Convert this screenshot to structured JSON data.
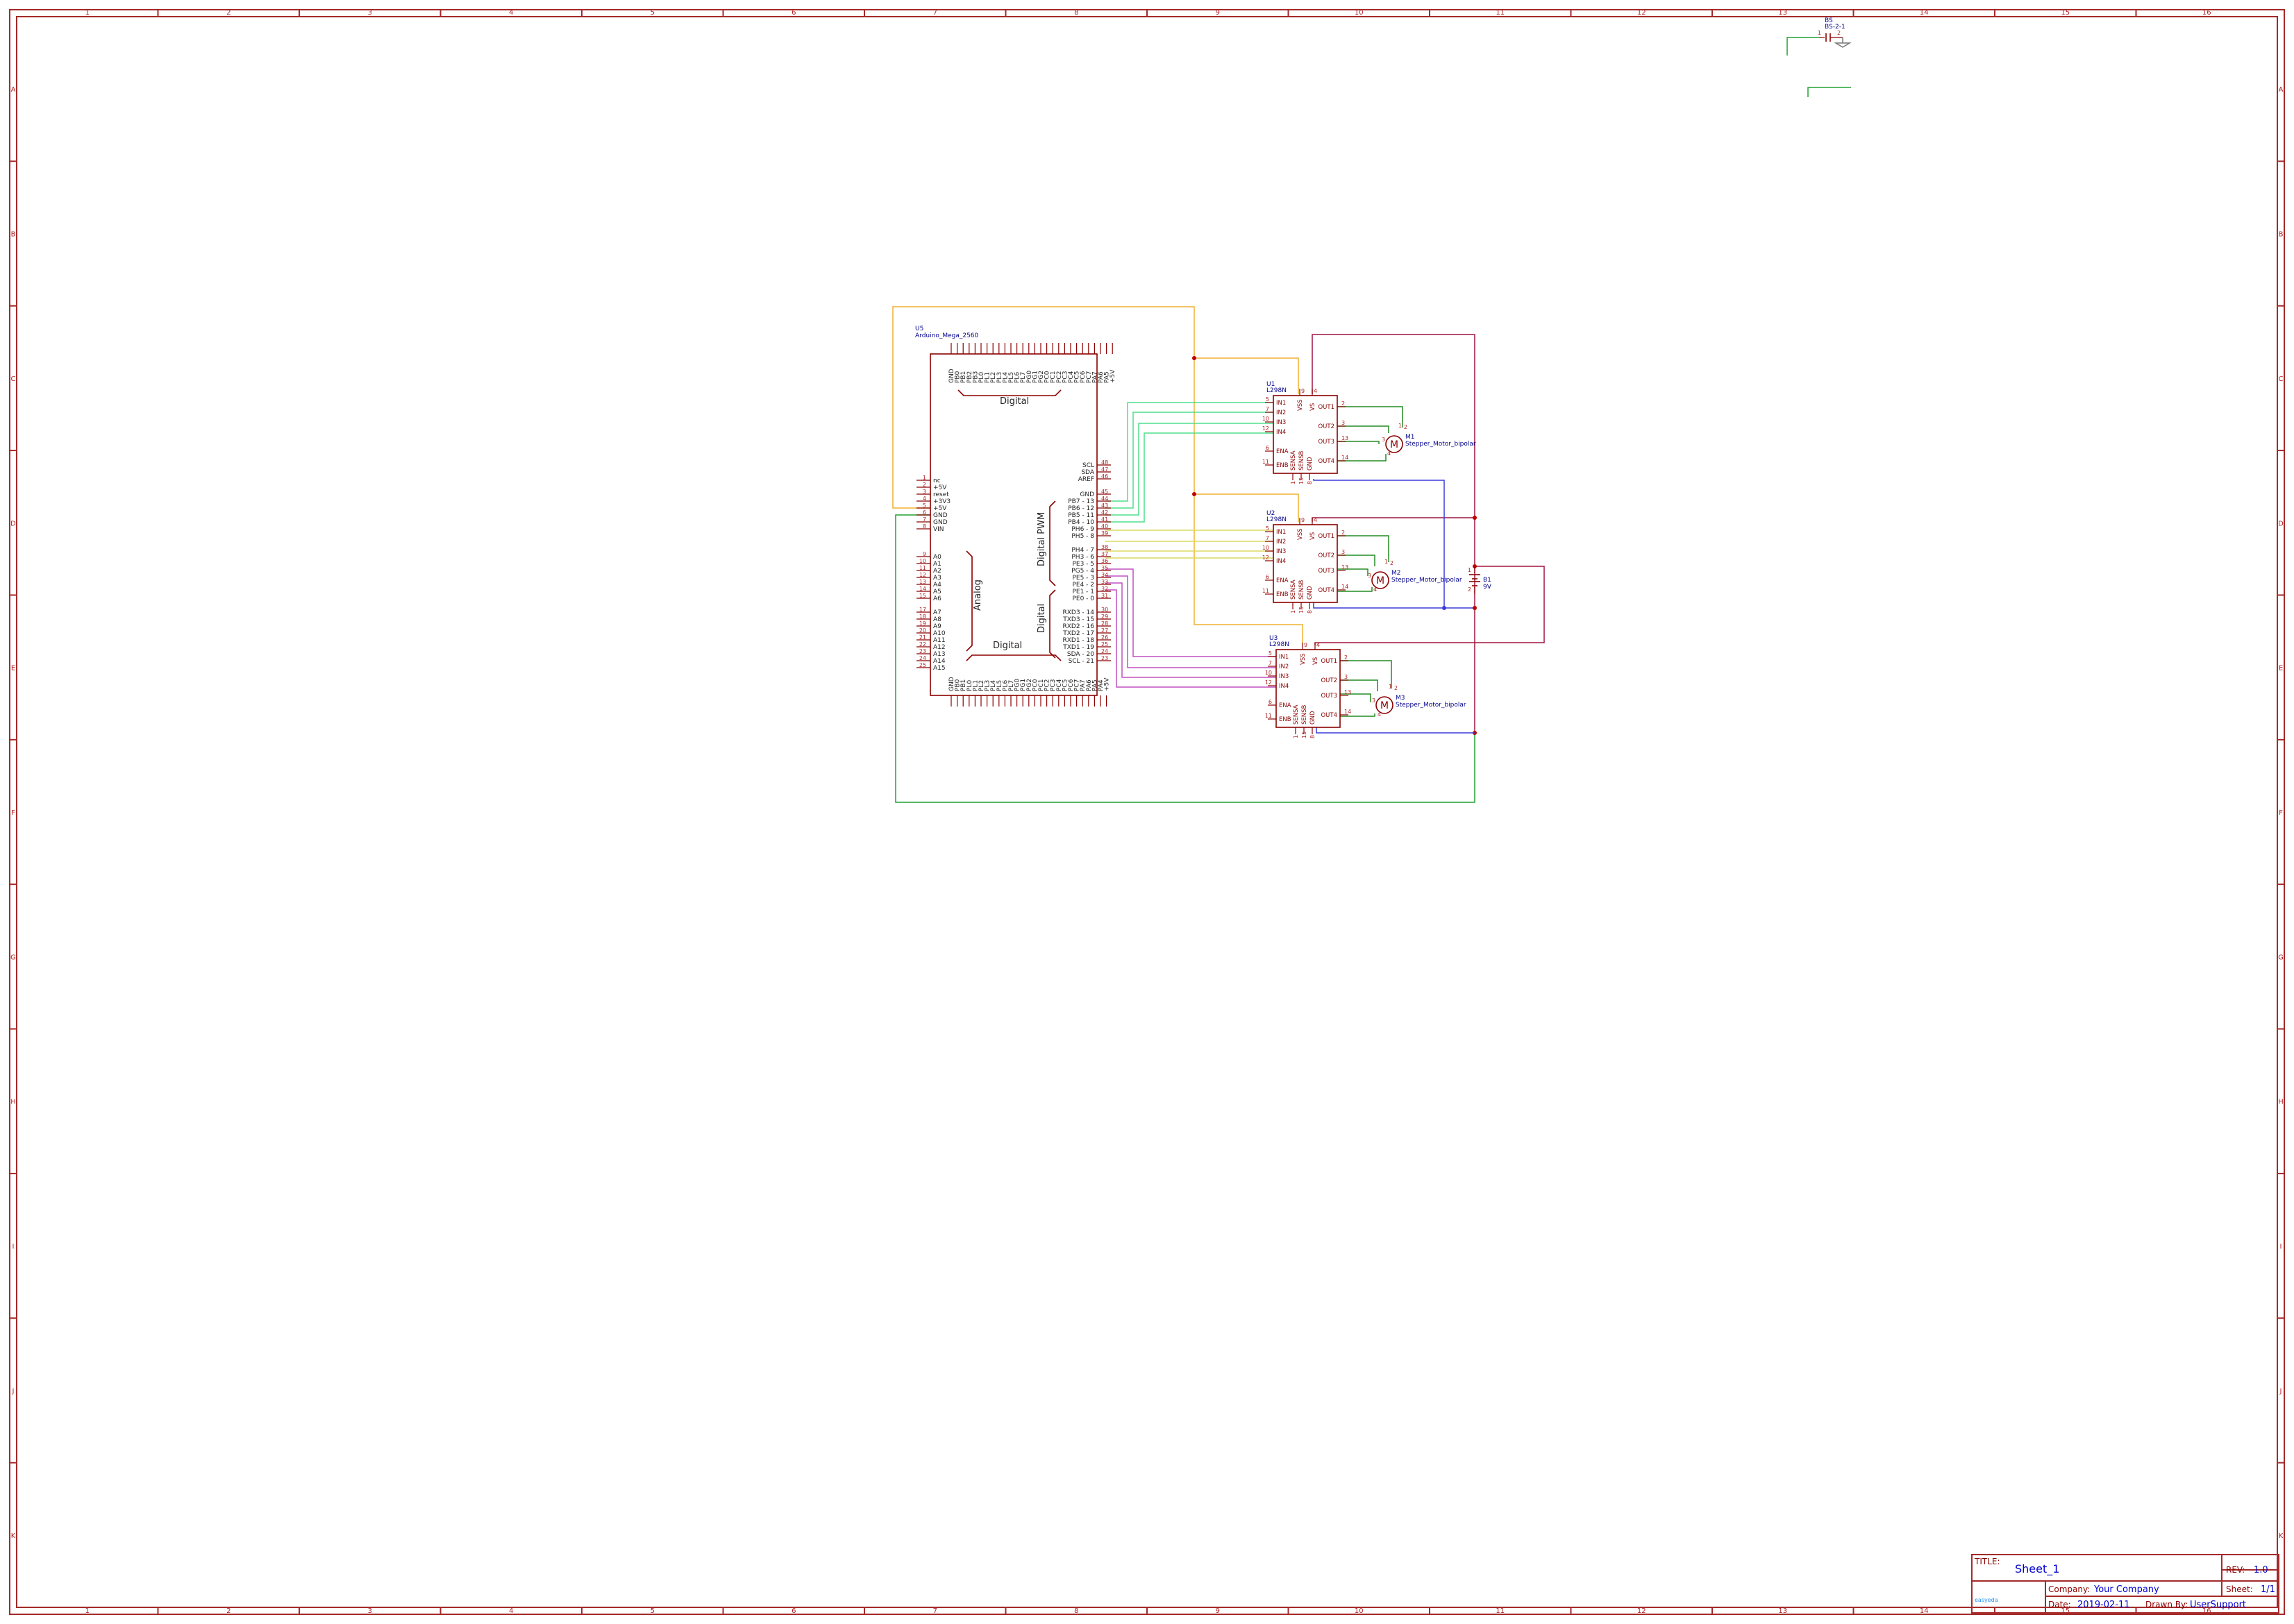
{
  "colors": {
    "frame": "#a52a2a",
    "component": "#8b0000",
    "reference": "#00008b",
    "wire_power": "#a0153e",
    "wire_gnd_bus": "#22a033",
    "wire_motor": "#228b22",
    "wire_yellow": "#f0b030",
    "wire_blue": "#3b3bdb",
    "wire_green_light": "#4ddf8c",
    "wire_yellow_light": "#dada60",
    "wire_violet": "#c050c0"
  },
  "frame": {
    "columns": [
      "1",
      "2",
      "3",
      "4",
      "5",
      "6",
      "7",
      "8",
      "9",
      "10",
      "11",
      "12",
      "13",
      "14",
      "15",
      "16"
    ],
    "rows": [
      "A",
      "B",
      "C",
      "D",
      "E",
      "F",
      "G",
      "H",
      "I",
      "J",
      "K"
    ]
  },
  "arduino": {
    "ref": "U5",
    "value": "Arduino_Mega_2560",
    "top_pins": [
      "GND",
      "PB0",
      "PB1",
      "PB2",
      "PB3",
      "PL0",
      "PL1",
      "PL2",
      "PL3",
      "PL4",
      "PL5",
      "PL6",
      "PL7",
      "PG0",
      "PG1",
      "PG2",
      "PC0",
      "PC1",
      "PC2",
      "PC3",
      "PC4",
      "PC5",
      "PC6",
      "PC7",
      "PA7",
      "PA6",
      "PA5",
      "+5V"
    ],
    "bottom_pins": [
      "GND",
      "PB0",
      "PB1",
      "PL0",
      "PL1",
      "PL2",
      "PL3",
      "PL4",
      "PL5",
      "PL6",
      "PL7",
      "PG0",
      "PG1",
      "PG2",
      "PC0",
      "PC1",
      "PC2",
      "PC3",
      "PC4",
      "PC5",
      "PC6",
      "PC7",
      "PA7",
      "PA6",
      "PA5",
      "PA4",
      "+5V"
    ],
    "left_power": [
      {
        "num": "1",
        "name": "nc"
      },
      {
        "num": "2",
        "name": "+5V"
      },
      {
        "num": "3",
        "name": "reset"
      },
      {
        "num": "4",
        "name": "+3V3"
      },
      {
        "num": "5",
        "name": "+5V"
      },
      {
        "num": "6",
        "name": "GND"
      },
      {
        "num": "7",
        "name": "GND"
      },
      {
        "num": "8",
        "name": "VIN"
      }
    ],
    "left_analog_a": [
      {
        "num": "9",
        "name": "A0"
      },
      {
        "num": "10",
        "name": "A1"
      },
      {
        "num": "11",
        "name": "A2"
      },
      {
        "num": "12",
        "name": "A3"
      },
      {
        "num": "13",
        "name": "A4"
      },
      {
        "num": "14",
        "name": "A5"
      },
      {
        "num": "15",
        "name": "A6"
      }
    ],
    "left_analog_b": [
      {
        "num": "17",
        "name": "A7"
      },
      {
        "num": "18",
        "name": "A8"
      },
      {
        "num": "19",
        "name": "A9"
      },
      {
        "num": "20",
        "name": "A10"
      },
      {
        "num": "21",
        "name": "A11"
      },
      {
        "num": "22",
        "name": "A12"
      },
      {
        "num": "23",
        "name": "A13"
      },
      {
        "num": "24",
        "name": "A14"
      },
      {
        "num": "25",
        "name": "A15"
      }
    ],
    "right_top": [
      {
        "num": "48",
        "name": "SCL"
      },
      {
        "num": "47",
        "name": "SDA"
      },
      {
        "num": "46",
        "name": "AREF"
      }
    ],
    "right_pwm": [
      {
        "num": "45",
        "name": "GND"
      },
      {
        "num": "44",
        "name": "PB7 - 13"
      },
      {
        "num": "43",
        "name": "PB6 - 12"
      },
      {
        "num": "42",
        "name": "PB5 - 11"
      },
      {
        "num": "41",
        "name": "PB4 - 10"
      },
      {
        "num": "40",
        "name": "PH6 - 9"
      },
      {
        "num": "39",
        "name": "PH5 - 8"
      }
    ],
    "right_pwm2": [
      {
        "num": "38",
        "name": "PH4 - 7"
      },
      {
        "num": "37",
        "name": "PH3 - 6"
      },
      {
        "num": "36",
        "name": "PE3 - 5"
      },
      {
        "num": "35",
        "name": "PG5 - 4"
      },
      {
        "num": "34",
        "name": "PE5 - 3"
      },
      {
        "num": "33",
        "name": "PE4 - 2"
      },
      {
        "num": "32",
        "name": "PE1 - 1"
      },
      {
        "num": "31",
        "name": "PE0 - 0"
      }
    ],
    "right_comm": [
      {
        "num": "30",
        "name": "RXD3 - 14"
      },
      {
        "num": "29",
        "name": "TXD3 - 15"
      },
      {
        "num": "28",
        "name": "RXD2 - 16"
      },
      {
        "num": "27",
        "name": "TXD2 - 17"
      },
      {
        "num": "26",
        "name": "RXD1 - 18"
      },
      {
        "num": "25",
        "name": "TXD1 - 19"
      },
      {
        "num": "24",
        "name": "SDA - 20"
      },
      {
        "num": "23",
        "name": "SCL - 21"
      }
    ],
    "section_labels": {
      "digital_top": "Digital",
      "digital_bottom": "Digital",
      "digital_pwm": "Digital PWM",
      "analog": "Analog",
      "digital_side": "Digital"
    }
  },
  "drivers": [
    {
      "ref": "U1",
      "value": "L298N"
    },
    {
      "ref": "U2",
      "value": "L298N"
    },
    {
      "ref": "U3",
      "value": "L298N"
    }
  ],
  "driver_pins": {
    "inputs": [
      {
        "num": "5",
        "name": "IN1"
      },
      {
        "num": "7",
        "name": "IN2"
      },
      {
        "num": "10",
        "name": "IN3"
      },
      {
        "num": "12",
        "name": "IN4"
      }
    ],
    "enables": [
      {
        "num": "6",
        "name": "ENA"
      },
      {
        "num": "11",
        "name": "ENB"
      }
    ],
    "outputs": [
      {
        "num": "2",
        "name": "OUT1"
      },
      {
        "num": "3",
        "name": "OUT2"
      },
      {
        "num": "13",
        "name": "OUT3"
      },
      {
        "num": "14",
        "name": "OUT4"
      }
    ],
    "top": [
      {
        "num": "9",
        "name": "VSS"
      },
      {
        "num": "4",
        "name": "VS"
      }
    ],
    "bottom": [
      {
        "num": "1",
        "name": "SENSA"
      },
      {
        "num": "15",
        "name": "SENSB"
      },
      {
        "num": "8",
        "name": "GND"
      }
    ]
  },
  "motors": [
    {
      "ref": "M1",
      "value": "Stepper_Motor_bipolar",
      "symbol": "M"
    },
    {
      "ref": "M2",
      "value": "Stepper_Motor_bipolar",
      "symbol": "M"
    },
    {
      "ref": "M3",
      "value": "Stepper_Motor_bipolar",
      "symbol": "M"
    }
  ],
  "motor_pins": [
    "1",
    "2",
    "3",
    "4"
  ],
  "battery": {
    "ref": "B1",
    "value": "9V",
    "pin_plus": "1",
    "pin_minus": "2"
  },
  "bs_part": {
    "ref": "BS",
    "value": "BS-2-1",
    "pin1": "1",
    "pin2": "2"
  },
  "title_block": {
    "title_label": "TITLE:",
    "title": "Sheet_1",
    "rev_label": "REV:",
    "rev": "1.0",
    "company_label": "Company:",
    "company": "Your Company",
    "sheet_label": "Sheet:",
    "sheet": "1/1",
    "date_label": "Date:",
    "date": "2019-02-11",
    "drawn_label": "Drawn By:",
    "drawn_by": "UserSupport",
    "logo_text": "easyeda"
  }
}
